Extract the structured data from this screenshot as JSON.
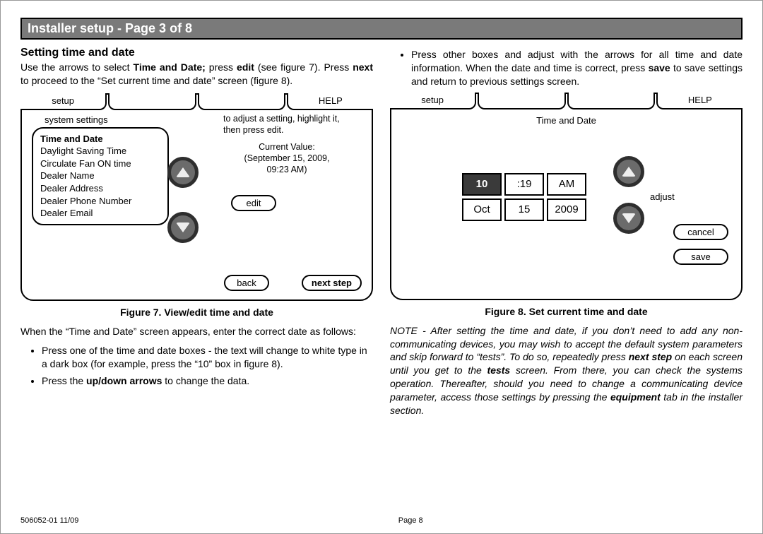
{
  "header": {
    "title": "Installer setup - Page 3 of 8"
  },
  "left": {
    "section_title": "Setting time and date",
    "intro_a": "Use the arrows to select ",
    "intro_b": "Time and Date;",
    "intro_c": "  press ",
    "intro_d": "edit",
    "intro_e": " (see figure 7). Press ",
    "intro_f": "next",
    "intro_g": " to proceed to the “Set current time and date” screen (figure 8).",
    "screen1": {
      "tab_setup": "setup",
      "tab_help": "HELP",
      "syslabel": "system settings",
      "hint": "to adjust a setting, highlight it, then press edit.",
      "list": {
        "selected": "Time and Date",
        "items": [
          "Daylight Saving Time",
          "Circulate Fan ON time",
          "Dealer Name",
          "Dealer Address",
          "Dealer Phone Number",
          "Dealer Email"
        ]
      },
      "curval_label": "Current Value:",
      "curval_line1": "(September 15, 2009,",
      "curval_line2": "09:23 AM)",
      "edit": "edit",
      "back": "back",
      "next": "next step"
    },
    "caption1": "Figure  7. View/edit time and date",
    "mid_para": "When the “Time and Date” screen appears, enter the correct date as follows:",
    "bullets": [
      {
        "a": "Press one of the time and date boxes - the text will change to white type in a dark box (for example, press the “10” box in figure 8).",
        "bold": ""
      },
      {
        "a": "Press the ",
        "bold": "up/down arrows",
        "b": " to change the data."
      }
    ]
  },
  "right": {
    "bullet_a": "Press other  boxes and adjust with the arrows for all time and date information. When the date and time is correct, press ",
    "bullet_b": "save",
    "bullet_c": " to save settings and return to previous settings screen.",
    "screen2": {
      "tab_setup": "setup",
      "tab_help": "HELP",
      "title": "Time and Date",
      "cells": {
        "hour": "10",
        "minute": ":19",
        "ampm": "AM",
        "month": "Oct",
        "day": "15",
        "year": "2009"
      },
      "adjust": "adjust",
      "cancel": "cancel",
      "save": "save"
    },
    "caption2": "Figure 8. Set current time and date",
    "note_a": "NOTE - After setting the time and date, if you don’t need to add any non-communicating devices, you may wish to accept the default system parameters and skip forward to “tests”. To do so, repeatedly press ",
    "note_b": "next step",
    "note_c": " on each screen until you get to the ",
    "note_d": "tests",
    "note_e": " screen. From there, you can check the systems operation. Thereafter, should you need to change a communicating device parameter, access those settings by pressing the ",
    "note_f": "equipment",
    "note_g": " tab in the installer section."
  },
  "footer": {
    "docnum": "506052-01 11/09",
    "pagenum": "Page 8"
  }
}
